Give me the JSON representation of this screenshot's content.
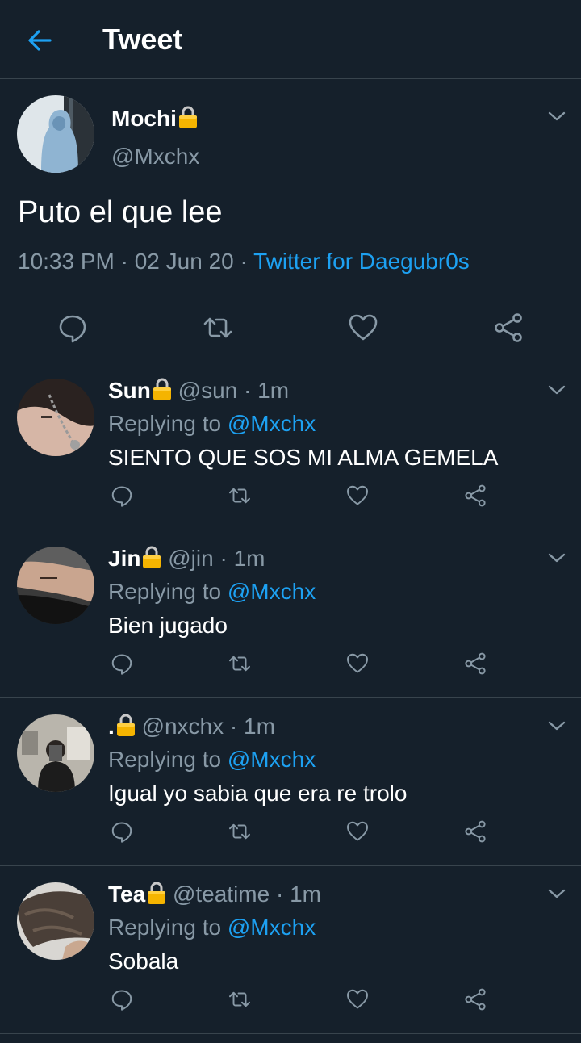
{
  "header": {
    "title": "Tweet"
  },
  "tweet": {
    "author_name": "Mochi",
    "author_handle": "@Mxchx",
    "text": "Puto el que lee",
    "time": "10:33 PM · 02 Jun 20 · ",
    "source": "Twitter for Daegubr0s"
  },
  "replies": [
    {
      "name": "Sun",
      "handle": "@sun · 1m",
      "replying_label": "Replying to ",
      "mention": "@Mxchx",
      "text": "SIENTO QUE SOS MI ALMA GEMELA"
    },
    {
      "name": "Jin",
      "handle": "@jin · 1m",
      "replying_label": "Replying to ",
      "mention": "@Mxchx",
      "text": "Bien jugado"
    },
    {
      "name": ".",
      "handle": "@nxchx · 1m",
      "replying_label": "Replying to ",
      "mention": "@Mxchx",
      "text": "Igual yo sabia que era re trolo"
    },
    {
      "name": "Tea",
      "handle": "@teatime · 1m",
      "replying_label": "Replying to ",
      "mention": "@Mxchx",
      "text": "Sobala"
    }
  ],
  "colors": {
    "background": "#15202b",
    "accent": "#1da1f2",
    "secondary_text": "#8899a6",
    "divider": "#38444d",
    "lock": "#f5b400"
  },
  "icons": [
    "back-arrow-icon",
    "lock-icon",
    "chevron-down-icon",
    "reply-icon",
    "retweet-icon",
    "like-icon",
    "share-icon"
  ]
}
